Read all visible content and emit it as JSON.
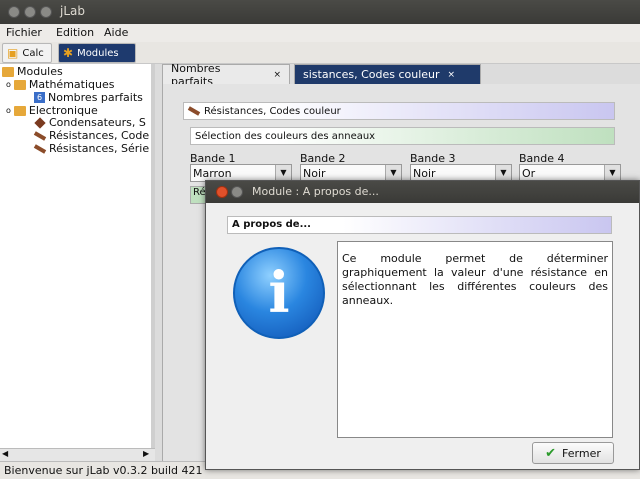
{
  "window": {
    "title": "jLab"
  },
  "menu": {
    "items": [
      "Fichier",
      "Edition",
      "Aide"
    ]
  },
  "toolbar": {
    "calc_label": "Calc",
    "modules_label": "Modules"
  },
  "tree": {
    "root": "Modules",
    "math_group": "Mathématiques",
    "math_items": [
      "Nombres parfaits"
    ],
    "elec_group": "Electronique",
    "elec_items": [
      "Condensateurs, S",
      "Résistances, Code",
      "Résistances, Série"
    ]
  },
  "tabs": [
    {
      "label": "Nombres parfaits",
      "close": "×"
    },
    {
      "label": "sistances, Codes couleur",
      "close": "×"
    }
  ],
  "panel": {
    "header": "Résistances, Codes couleur",
    "section": "Sélection des couleurs des anneaux",
    "bands": [
      {
        "label": "Bande 1",
        "value": "Marron"
      },
      {
        "label": "Bande 2",
        "value": "Noir"
      },
      {
        "label": "Bande 3",
        "value": "Noir"
      },
      {
        "label": "Bande 4",
        "value": "Or"
      }
    ],
    "result_stub": "Ré"
  },
  "dialog": {
    "title": "Module : A propos de...",
    "header": "A propos de...",
    "icon_glyph": "i",
    "description": "Ce module permet de déterminer graphiquement la valeur d'une résistance en sélectionnant les différentes couleurs des anneaux.",
    "close_label": "Fermer"
  },
  "status": {
    "text": "Bienvenue sur jLab v0.3.2 build 421"
  },
  "colors": {
    "selected_tab": "#1f3a6a",
    "dialog_close": "#e0502a",
    "info_icon": "#2a86e0"
  }
}
